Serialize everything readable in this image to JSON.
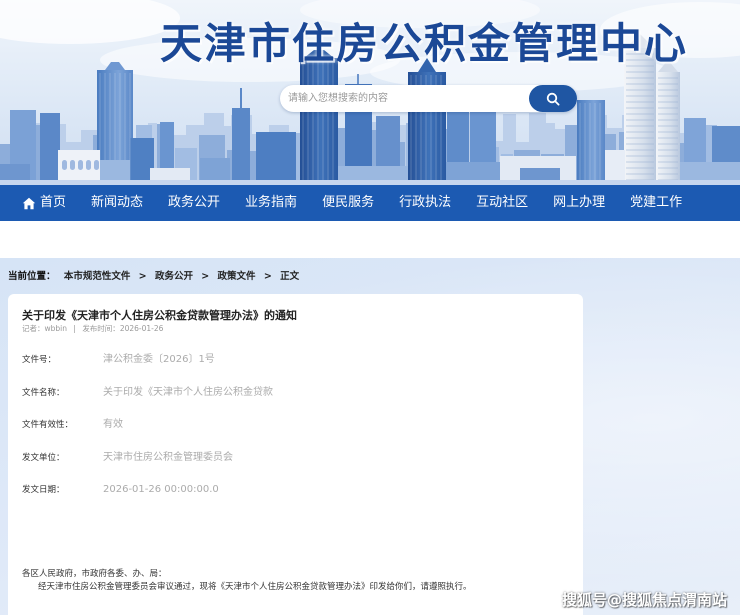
{
  "site": {
    "title": "天津市住房公积金管理中心"
  },
  "search": {
    "placeholder": "请输入您想搜索的内容",
    "icon": "search-icon"
  },
  "nav": {
    "items": [
      {
        "label": "首页",
        "icon": "home-icon"
      },
      {
        "label": "新闻动态"
      },
      {
        "label": "政务公开"
      },
      {
        "label": "业务指南"
      },
      {
        "label": "便民服务"
      },
      {
        "label": "行政执法"
      },
      {
        "label": "互动社区"
      },
      {
        "label": "网上办理"
      },
      {
        "label": "党建工作"
      }
    ]
  },
  "breadcrumb": {
    "label": "当前位置：",
    "separator": ">",
    "items": [
      "本市规范性文件",
      "政务公开",
      "政策文件",
      "正文"
    ]
  },
  "article": {
    "title": "关于印发《天津市个人住房公积金贷款管理办法》的通知",
    "meta": {
      "author_label": "记者：",
      "author": "wbbin",
      "divider": "|",
      "date_label": "发布时间：",
      "date": "2026-01-26"
    },
    "fields": [
      {
        "label": "文件号：",
        "value": "津公积金委〔2026〕1号"
      },
      {
        "label": "文件名称：",
        "value": "关于印发《天津市个人住房公积金贷款"
      },
      {
        "label": "文件有效性：",
        "value": "有效"
      },
      {
        "label": "发文单位：",
        "value": "天津市住房公积金管理委员会"
      },
      {
        "label": "发文日期：",
        "value": "2026-01-26 00:00:00.0"
      }
    ],
    "body": [
      "各区人民政府，市政府各委、办、局：",
      "经天津市住房公积金管理委员会审议通过，现将《天津市个人住房公积金贷款管理办法》印发给你们，请遵照执行。"
    ]
  },
  "watermark": "搜狐号@搜狐焦点渭南站",
  "colors": {
    "primary": "#1c5ab2",
    "title": "#1b4896",
    "search_button": "#1f56a3",
    "page_bg": "#dbe7f7"
  }
}
